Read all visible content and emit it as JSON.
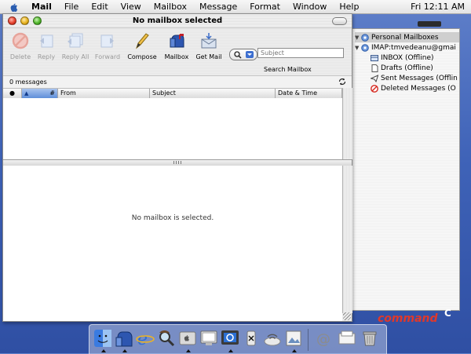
{
  "menubar": {
    "items": [
      "Mail",
      "File",
      "Edit",
      "View",
      "Mailbox",
      "Message",
      "Format",
      "Window",
      "Help"
    ],
    "clock": "Fri 12:11 AM"
  },
  "window": {
    "title": "No mailbox selected",
    "toolbar": {
      "delete": "Delete",
      "reply": "Reply",
      "reply_all": "Reply All",
      "forward": "Forward",
      "compose": "Compose",
      "mailbox": "Mailbox",
      "get_mail": "Get Mail",
      "search_placeholder": "Subject",
      "search_label": "Search Mailbox"
    },
    "message_count": "0 messages",
    "columns": [
      "●",
      "#",
      "From",
      "Subject",
      "Date & Time"
    ],
    "preview_text": "No mailbox is selected."
  },
  "drawer": {
    "items": [
      {
        "label": "Personal Mailboxes",
        "icon": "personal-mailbox-icon",
        "level": 0
      },
      {
        "label": "IMAP:tmvedeanu@gmai",
        "icon": "imap-account-icon",
        "level": 0
      },
      {
        "label": "INBOX (Offline)",
        "icon": "inbox-icon",
        "level": 1
      },
      {
        "label": "Drafts (Offline)",
        "icon": "drafts-icon",
        "level": 1
      },
      {
        "label": "Sent Messages (Offlin",
        "icon": "sent-icon",
        "level": 1
      },
      {
        "label": "Deleted Messages (O",
        "icon": "deleted-icon",
        "level": 1
      }
    ]
  },
  "dock": {
    "icons": [
      "finder-icon",
      "mail-icon",
      "internet-explorer-icon",
      "sherlock-icon",
      "system-preferences-icon",
      "terminal-icon",
      "quicktime-icon",
      "x-app-icon",
      "airport-icon",
      "preview-icon",
      "mail-document-icon",
      "trash-icon"
    ]
  },
  "brand": {
    "text": "command",
    "mark": "C"
  },
  "colors": {
    "desktop": "#3f63b8",
    "selection": "#5f8fd9",
    "deleted_red": "#d6281f"
  }
}
